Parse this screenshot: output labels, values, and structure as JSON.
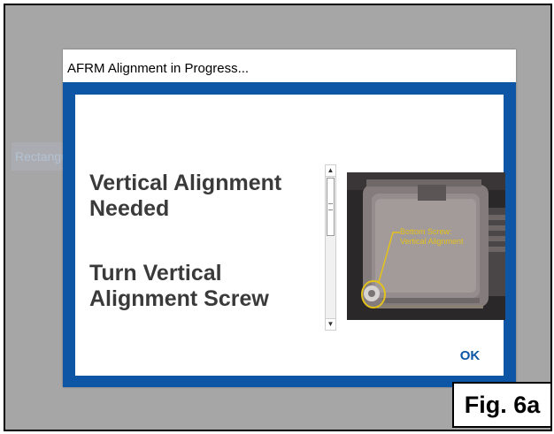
{
  "dialog": {
    "title": "AFRM Alignment in Progress...",
    "message_line1": "Vertical Alignment Needed",
    "message_line2": "Turn Vertical Alignment Screw",
    "ok_label": "OK"
  },
  "photo": {
    "annotation_line1": "Bottom Screw:",
    "annotation_line2": "Vertical Alignment"
  },
  "background": {
    "ghost_text": "Rectangular Snip"
  },
  "figure_label": "Fig. 6a",
  "colors": {
    "accent": "#0d56a6",
    "annotation": "#e3c21c",
    "background": "#a6a6a6"
  }
}
